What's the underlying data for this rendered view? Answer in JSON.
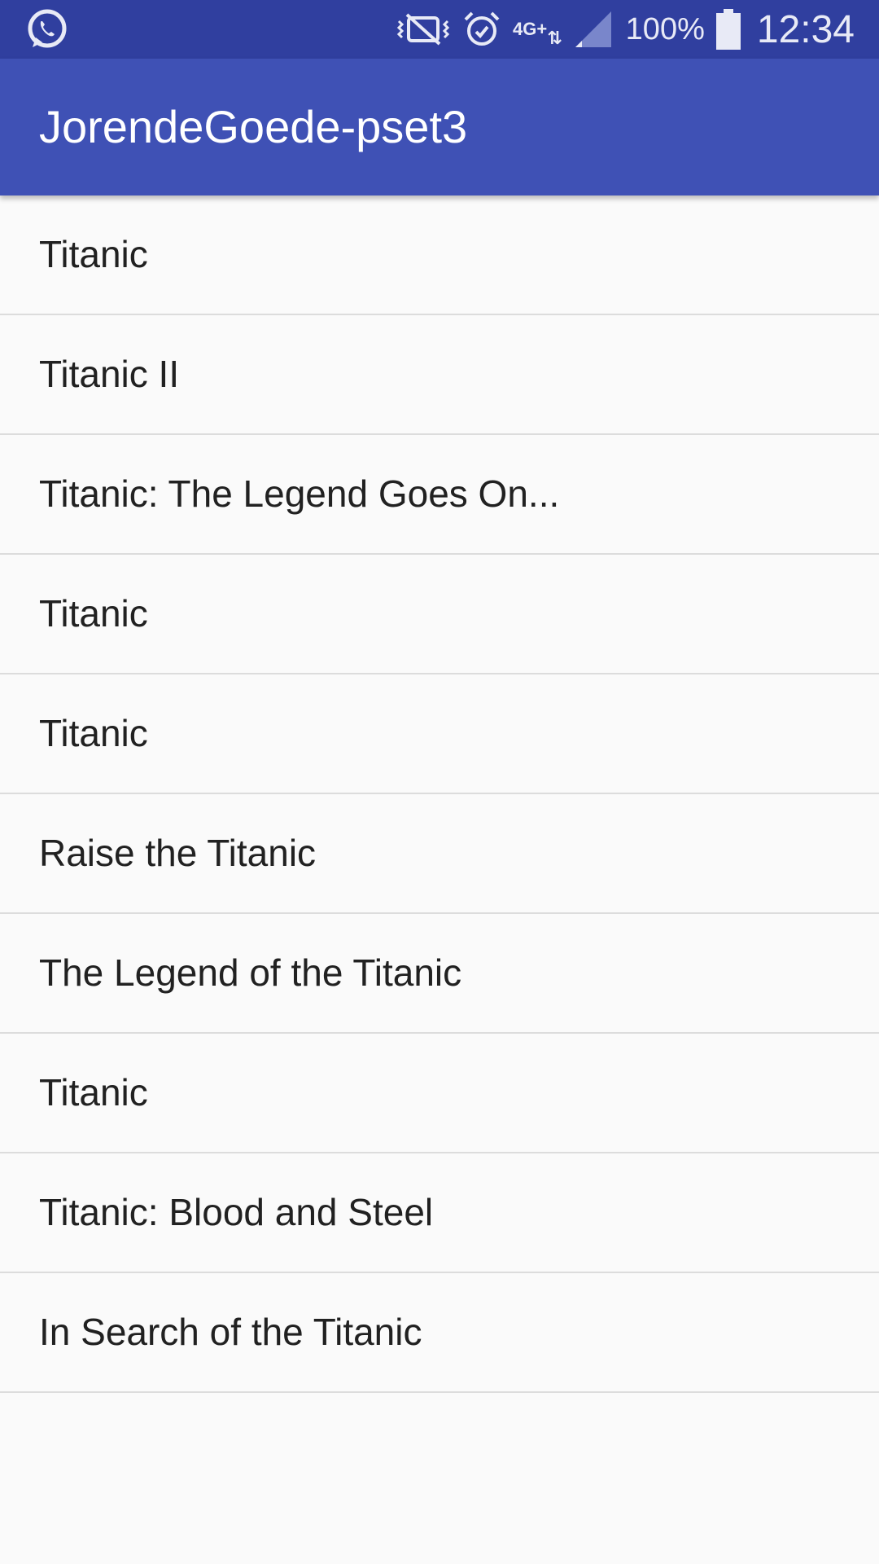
{
  "status_bar": {
    "left_icon": "whatsapp-icon",
    "icons": [
      "vibrate-icon",
      "alarm-icon",
      "network-4g-icon",
      "signal-icon"
    ],
    "network_label": "4G+",
    "battery_percent": "100%",
    "time": "12:34"
  },
  "app_bar": {
    "title": "JorendeGoede-pset3",
    "color": "#3f51b5"
  },
  "colors": {
    "status_bar": "#303f9f",
    "app_bar": "#3f51b5",
    "background": "#fafafa",
    "divider": "#dcdcdc"
  },
  "movies": [
    {
      "title": "Titanic"
    },
    {
      "title": "Titanic II"
    },
    {
      "title": "Titanic: The Legend Goes On..."
    },
    {
      "title": "Titanic"
    },
    {
      "title": "Titanic"
    },
    {
      "title": "Raise the Titanic"
    },
    {
      "title": "The Legend of the Titanic"
    },
    {
      "title": "Titanic"
    },
    {
      "title": "Titanic: Blood and Steel"
    },
    {
      "title": "In Search of the Titanic"
    }
  ]
}
